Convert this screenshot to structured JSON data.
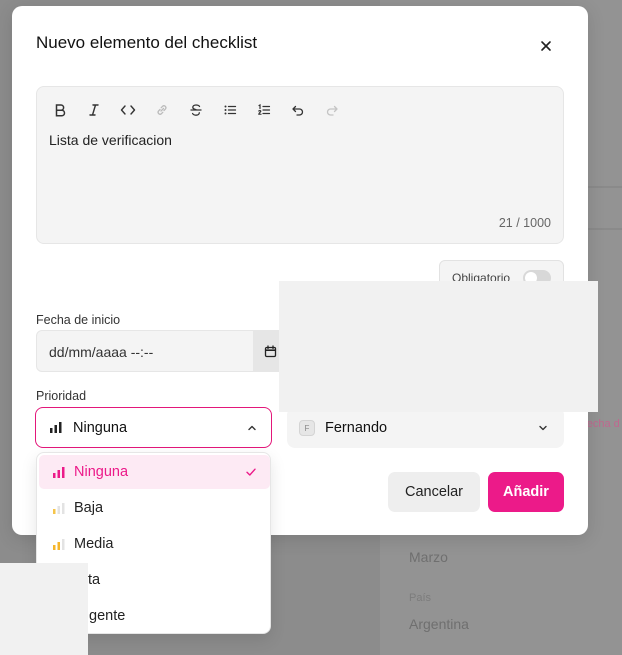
{
  "background": {
    "labels": [
      "Marzo",
      "País",
      "Argentina"
    ],
    "pink_text": "Fecha d"
  },
  "modal": {
    "title": "Nuevo elemento del checklist",
    "close_icon": "close-icon"
  },
  "editor": {
    "toolbar": [
      {
        "name": "bold-icon"
      },
      {
        "name": "italic-icon"
      },
      {
        "name": "code-icon"
      },
      {
        "name": "link-icon"
      },
      {
        "name": "strikethrough-icon"
      },
      {
        "name": "bullet-list-icon"
      },
      {
        "name": "ordered-list-icon"
      },
      {
        "name": "undo-icon"
      },
      {
        "name": "redo-icon"
      }
    ],
    "text": "Lista de verificacion",
    "char_count": "21 / 1000"
  },
  "obligatorio": {
    "label": "Obligatorio",
    "checked": false
  },
  "start_date": {
    "label": "Fecha de inicio",
    "value": "dd/mm/aaaa  --:--"
  },
  "priority": {
    "label": "Prioridad",
    "selected": "Ninguna",
    "options": [
      {
        "label": "Ninguna",
        "level": 3,
        "color": "#ec1a89",
        "selected": true
      },
      {
        "label": "Baja",
        "level": 1,
        "color": "#f5c44a",
        "selected": false
      },
      {
        "label": "Media",
        "level": 2,
        "color": "#f5b62a",
        "selected": false
      },
      {
        "label": "ta",
        "level": 0,
        "color": "#999999",
        "selected": false
      },
      {
        "label": "gente",
        "level": 0,
        "color": "#999999",
        "selected": false
      }
    ]
  },
  "assignee": {
    "initial": "F",
    "name": "Fernando"
  },
  "footer": {
    "cancel_label": "Cancelar",
    "add_label": "Añadir"
  },
  "colors": {
    "accent": "#ec1a89",
    "accent_soft": "#fdeaf4"
  }
}
